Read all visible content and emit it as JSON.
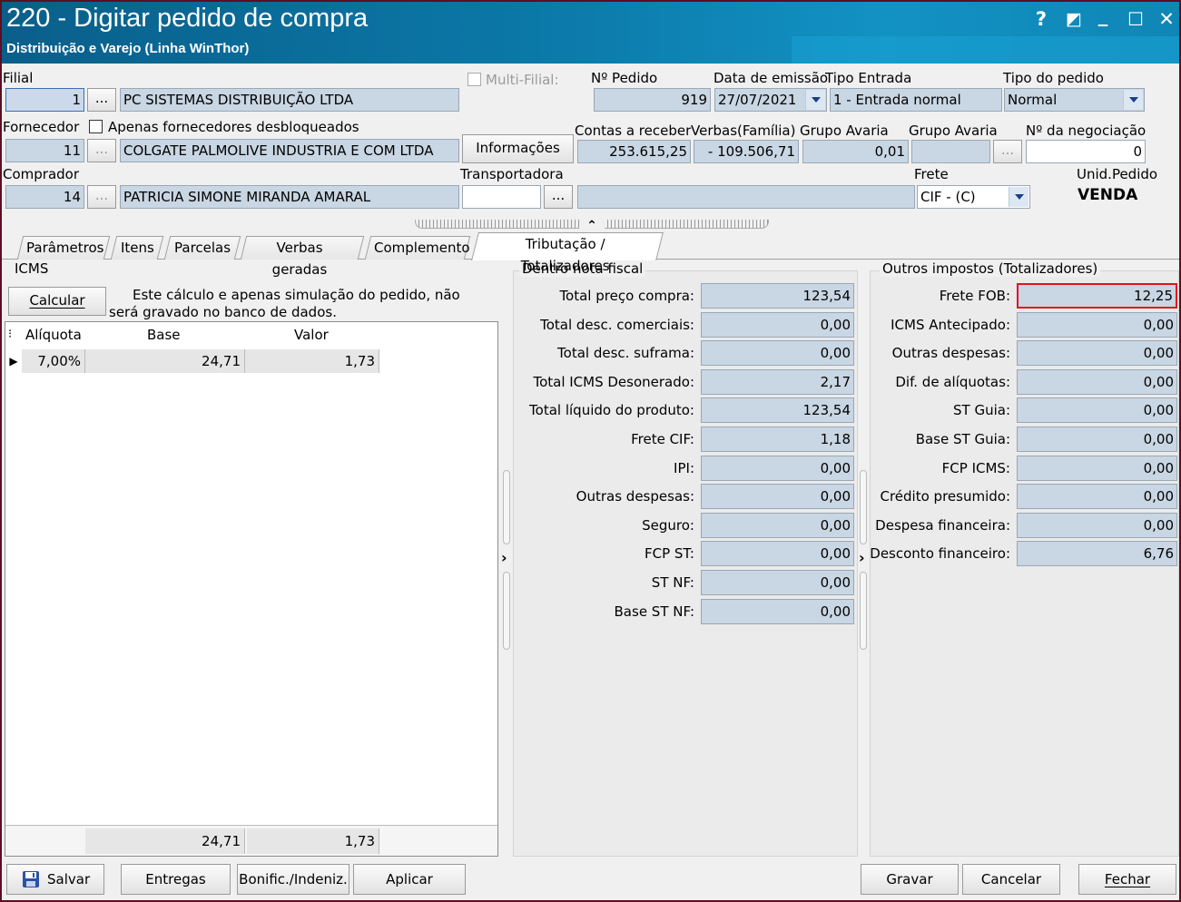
{
  "window": {
    "title": "220 - Digitar pedido de compra",
    "subtitle": "Distribuição e Varejo (Linha WinThor)",
    "controls": {
      "help": "?",
      "restore": "◩",
      "minimize": "_",
      "maximize": "☐",
      "close": "✕"
    }
  },
  "header": {
    "filial_label": "Filial",
    "filial_code": "1",
    "filial_name": "PC SISTEMAS DISTRIBUIÇÃO LTDA",
    "multi_filial_label": "Multi-Filial:",
    "pedido_label": "Nº Pedido",
    "pedido_value": "919",
    "data_emissao_label": "Data de emissão",
    "data_emissao_value": "27/07/2021",
    "tipo_entrada_label": "Tipo Entrada",
    "tipo_entrada_value": "1 - Entrada normal",
    "tipo_pedido_label": "Tipo do pedido",
    "tipo_pedido_value": "Normal",
    "fornecedor_label": "Fornecedor",
    "apenas_desbloq_label": "Apenas fornecedores desbloqueados",
    "fornecedor_code": "11",
    "fornecedor_name": "COLGATE PALMOLIVE INDUSTRIA  E COM LTDA",
    "informacoes_label": "Informações",
    "contas_receber_label": "Contas a receber",
    "contas_receber_value": "253.615,25",
    "verbas_label": "Verbas(Família)",
    "verbas_value": "- 109.506,71",
    "grupo_avaria_label1": "Grupo Avaria",
    "grupo_avaria_value1": "0,01",
    "grupo_avaria_label2": "Grupo Avaria",
    "grupo_avaria_value2": "",
    "negociacao_label": "Nº da negociação",
    "negociacao_value": "0",
    "comprador_label": "Comprador",
    "comprador_code": "14",
    "comprador_name": "PATRICIA SIMONE MIRANDA AMARAL",
    "transportadora_label": "Transportadora",
    "transportadora_value": "",
    "frete_label": "Frete",
    "frete_value": "CIF - (C)",
    "unid_pedido_label": "Unid.Pedido",
    "unid_pedido_value": "VENDA",
    "ellipsis": "...",
    "collapse_glyph": "⌃"
  },
  "tabs": [
    {
      "label": "Parâmetros"
    },
    {
      "label": "Itens"
    },
    {
      "label": "Parcelas"
    },
    {
      "label": "Verbas geradas"
    },
    {
      "label": "Complemento"
    },
    {
      "label": "Tributação / Totalizadores"
    }
  ],
  "icms": {
    "group_label": "ICMS",
    "calcular_label": "Calcular",
    "note": "Este cálculo e apenas  simulação do pedido, não será gravado no banco de dados.",
    "columns": [
      "Alíquota",
      "Base",
      "Valor"
    ],
    "rows": [
      {
        "aliquota": "7,00%",
        "base": "24,71",
        "valor": "1,73"
      }
    ],
    "totals": {
      "base": "24,71",
      "valor": "1,73"
    },
    "row_indicator": "▶",
    "header_icon": "⁝"
  },
  "dentro_nota": {
    "group_label": "Dentro nota fiscal",
    "items": [
      {
        "label": "Total preço compra:",
        "value": "123,54"
      },
      {
        "label": "Total desc. comerciais:",
        "value": "0,00"
      },
      {
        "label": "Total desc. suframa:",
        "value": "0,00"
      },
      {
        "label": "Total ICMS Desonerado:",
        "value": "2,17"
      },
      {
        "label": "Total líquido do produto:",
        "value": "123,54"
      },
      {
        "label": "Frete CIF:",
        "value": "1,18"
      },
      {
        "label": "IPI:",
        "value": "0,00"
      },
      {
        "label": "Outras despesas:",
        "value": "0,00"
      },
      {
        "label": "Seguro:",
        "value": "0,00"
      },
      {
        "label": "FCP ST:",
        "value": "0,00"
      },
      {
        "label": "ST NF:",
        "value": "0,00"
      },
      {
        "label": "Base ST NF:",
        "value": "0,00"
      }
    ]
  },
  "outros": {
    "group_label": "Outros impostos (Totalizadores)",
    "items": [
      {
        "label": "Frete FOB:",
        "value": "12,25"
      },
      {
        "label": "ICMS Antecipado:",
        "value": "0,00"
      },
      {
        "label": "Outras despesas:",
        "value": "0,00"
      },
      {
        "label": "Dif. de alíquotas:",
        "value": "0,00"
      },
      {
        "label": "ST Guia:",
        "value": "0,00"
      },
      {
        "label": "Base ST Guia:",
        "value": "0,00"
      },
      {
        "label": "FCP ICMS:",
        "value": "0,00"
      },
      {
        "label": "Crédito presumido:",
        "value": "0,00"
      },
      {
        "label": "Despesa financeira:",
        "value": "0,00"
      },
      {
        "label": "Desconto financeiro:",
        "value": "6,76"
      }
    ],
    "highlight_color": "#e0141e"
  },
  "footer": {
    "salvar": "Salvar",
    "entregas": "Entregas",
    "bonific": "Bonific./Indeniz.",
    "aplicar": "Aplicar",
    "gravar": "Gravar",
    "cancelar": "Cancelar",
    "fechar": "Fechar",
    "splitter_arrow": "›"
  }
}
